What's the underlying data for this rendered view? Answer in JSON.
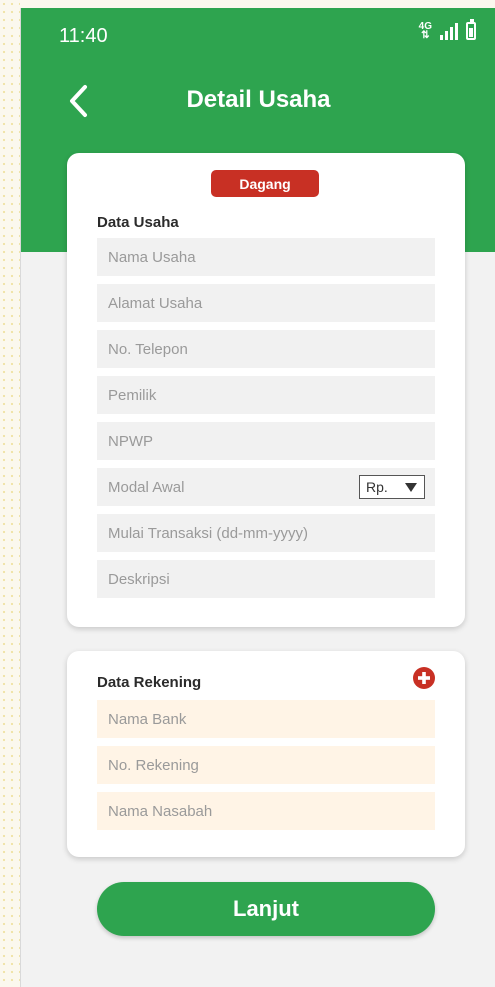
{
  "status_bar": {
    "time": "11:40",
    "network": "4G"
  },
  "header": {
    "title": "Detail Usaha"
  },
  "business_card": {
    "badge": "Dagang",
    "section_title": "Data Usaha",
    "fields": [
      "Nama Usaha",
      "Alamat Usaha",
      "No. Telepon",
      "Pemilik",
      "NPWP",
      "Modal Awal",
      "Mulai Transaksi (dd-mm-yyyy)",
      "Deskripsi"
    ],
    "currency_select": {
      "value": "Rp.",
      "icon": "triangle-down-icon"
    }
  },
  "account_card": {
    "section_title": "Data Rekening",
    "add_icon": "plus-circle-icon",
    "fields": [
      "Nama Bank",
      "No. Rekening",
      "Nama Nasabah"
    ]
  },
  "next_button": {
    "label": "Lanjut"
  },
  "colors": {
    "primary": "#2ea44f",
    "badge": "#c83024",
    "field_bg": "#f1f1f1",
    "bank_field_bg": "#fff4e6"
  }
}
